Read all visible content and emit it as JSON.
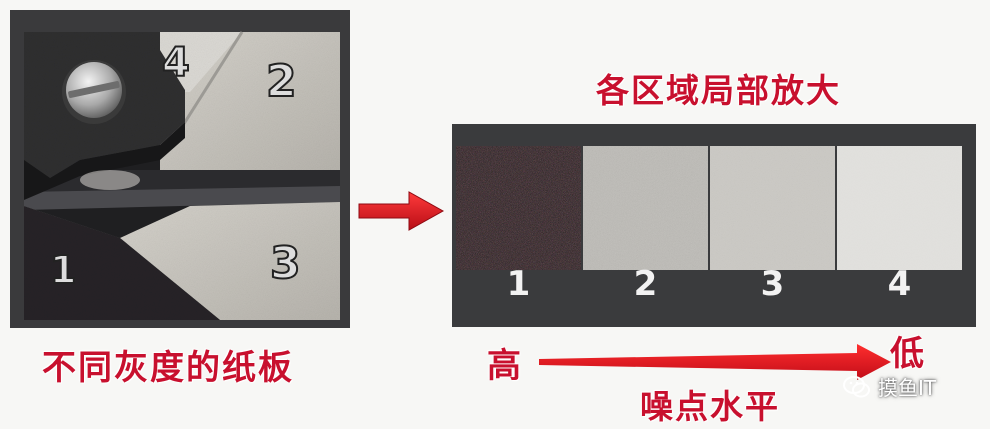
{
  "photo": {
    "labels": [
      "1",
      "2",
      "3",
      "4"
    ]
  },
  "captions": {
    "left": "不同灰度的纸板",
    "top": "各区域局部放大",
    "high": "高",
    "low": "低",
    "noise": "噪点水平"
  },
  "swatches": [
    {
      "label": "1",
      "color": "#1c1818"
    },
    {
      "label": "2",
      "color": "#bdbbb6"
    },
    {
      "label": "3",
      "color": "#cbc9c4"
    },
    {
      "label": "4",
      "color": "#e2e1de"
    }
  ],
  "watermark": {
    "text": "摸鱼IT",
    "icon": "wechat-icon"
  },
  "colors": {
    "accent_red": "#d3121f",
    "panel_bg": "#3a3b3d"
  }
}
